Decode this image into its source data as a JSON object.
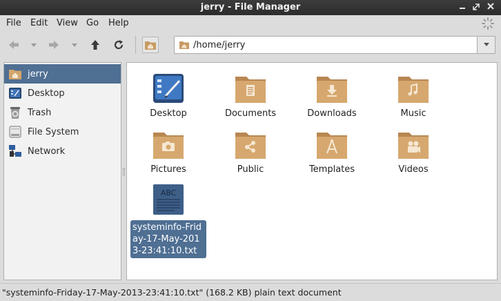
{
  "window": {
    "title": "jerry - File Manager",
    "controls": [
      "minimize-icon",
      "maximize-icon",
      "close-icon"
    ]
  },
  "menubar": {
    "items": [
      "File",
      "Edit",
      "View",
      "Go",
      "Help"
    ]
  },
  "toolbar": {
    "buttons": [
      "back-icon",
      "back-history-icon",
      "forward-icon",
      "forward-history-icon",
      "up-icon",
      "reload-icon",
      "home-icon"
    ],
    "location": "/home/jerry"
  },
  "sidebar": {
    "items": [
      {
        "label": "jerry",
        "icon": "home-folder-icon",
        "selected": true
      },
      {
        "label": "Desktop",
        "icon": "desktop-icon"
      },
      {
        "label": "Trash",
        "icon": "trash-icon"
      },
      {
        "label": "File System",
        "icon": "drive-icon"
      },
      {
        "label": "Network",
        "icon": "network-icon"
      }
    ]
  },
  "files": [
    {
      "name": "Desktop",
      "icon": "desktop-icon"
    },
    {
      "name": "Documents",
      "icon": "documents-folder-icon"
    },
    {
      "name": "Downloads",
      "icon": "downloads-folder-icon"
    },
    {
      "name": "Music",
      "icon": "music-folder-icon"
    },
    {
      "name": "Pictures",
      "icon": "pictures-folder-icon"
    },
    {
      "name": "Public",
      "icon": "public-folder-icon"
    },
    {
      "name": "Templates",
      "icon": "templates-folder-icon"
    },
    {
      "name": "Videos",
      "icon": "videos-folder-icon"
    },
    {
      "name": "systeminfo-Friday-17-May-2013-23:41:10.txt",
      "icon": "text-file-icon",
      "icon_text": "ABC",
      "selected": true
    }
  ],
  "status": "\"systeminfo-Friday-17-May-2013-23:41:10.txt\" (168.2 KB) plain text document",
  "colors": {
    "selection": "#4f6f93",
    "folder": "#c79a63",
    "titlebar": "#333333"
  }
}
